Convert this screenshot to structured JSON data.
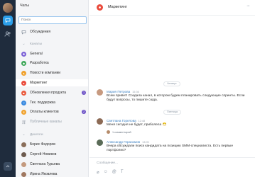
{
  "sidebar": {
    "title": "Чаты",
    "search_placeholder": "Поиск",
    "items": [
      {
        "label": "Обсуждения"
      },
      {
        "label": "Каналы"
      },
      {
        "label": "General"
      },
      {
        "label": "Разработка"
      },
      {
        "label": "Новости компании"
      },
      {
        "label": "Маркетинг"
      },
      {
        "label": "Обновления продукта",
        "badge": "1"
      },
      {
        "label": "Тех. поддержка"
      },
      {
        "label": "Оплаты клиентов",
        "badge": "2"
      },
      {
        "label": "Публичные каналы"
      },
      {
        "label": "Диалоги"
      },
      {
        "label": "Борис Федоров"
      },
      {
        "label": "Сергей Новиков"
      },
      {
        "label": "Светлана Гурьева"
      },
      {
        "label": "Ирина Яковлева"
      }
    ]
  },
  "header": {
    "channel_name": "Маркетинг"
  },
  "messages": {
    "date_1": "Четверг",
    "m1_author": "Мария Петрова",
    "m1_time": "15:36",
    "m1_text": "Всем привет! Создала канал, в котором будем планировать следующие спринты. Если будут вопросы, то пишите сюда.",
    "date_2": "Пятница",
    "m2_author": "Светлана Горелова",
    "m2_time": "12:48",
    "m2_text": "Меня сегодня не будет, приболела 😷",
    "m2_comments": "1 комментарий",
    "m3_author": "Александр Герасимов",
    "m3_time": "13:05",
    "m3_text": "Вчера обсуждали поиск кандидата на позицию SMM-специалиста. Есть первые портфолио?"
  },
  "composer": {
    "placeholder": "Сообщение..."
  }
}
